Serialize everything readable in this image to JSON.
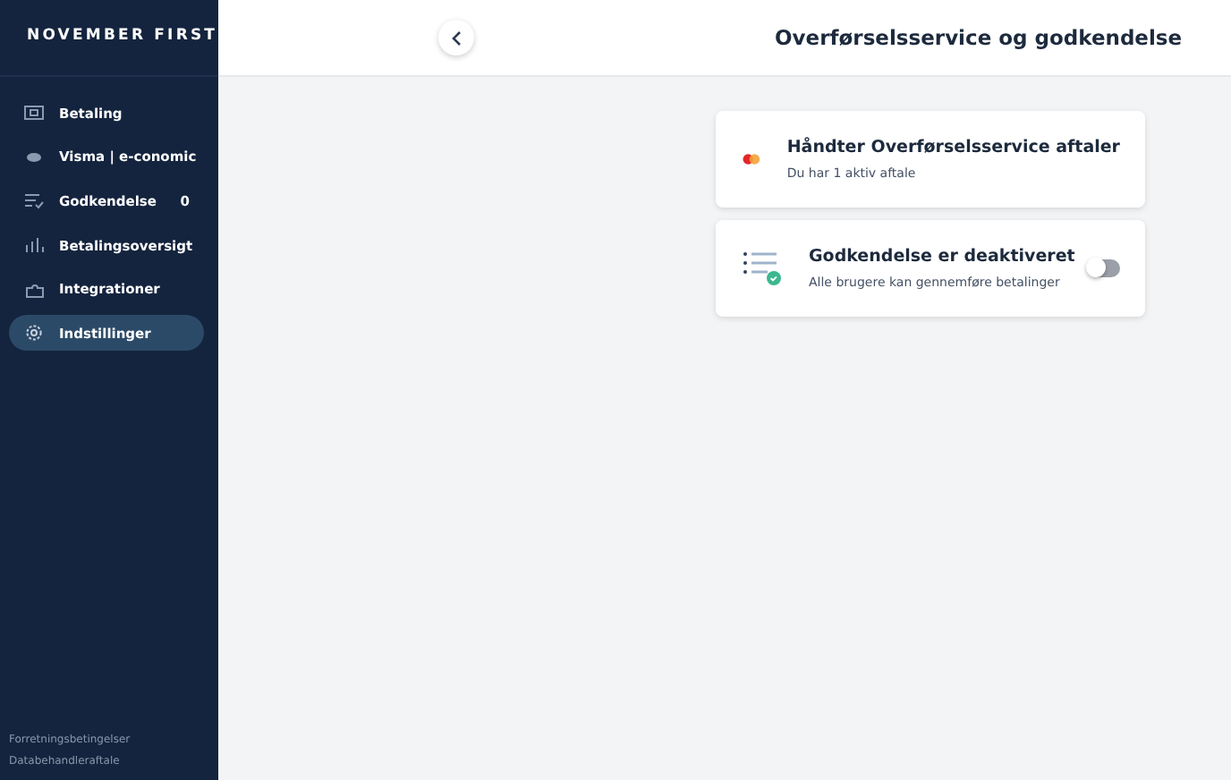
{
  "brand": "NOVEMBER FIRST",
  "sidebar": {
    "items": [
      {
        "label": "Betaling",
        "selected": false
      },
      {
        "label": "Visma | e-conomic",
        "selected": false
      },
      {
        "label": "Godkendelse",
        "count": "0",
        "selected": false
      },
      {
        "label": "Betalingsoversigt",
        "selected": false
      },
      {
        "label": "Integrationer",
        "selected": false
      },
      {
        "label": "Indstillinger",
        "selected": true
      }
    ],
    "footer_links": [
      "Forretningsbetingelser",
      "Databehandleraftale"
    ]
  },
  "header": {
    "title": "Overførselsservice og godkendelse"
  },
  "cards": [
    {
      "kind": "link",
      "title": "Håndter Overførselsservice aftaler",
      "subtitle": "Du har 1 aktiv aftale"
    },
    {
      "kind": "toggle",
      "title": "Godkendelse er deaktiveret",
      "subtitle": "Alle brugere kan gennemføre betalinger",
      "on": false
    }
  ]
}
